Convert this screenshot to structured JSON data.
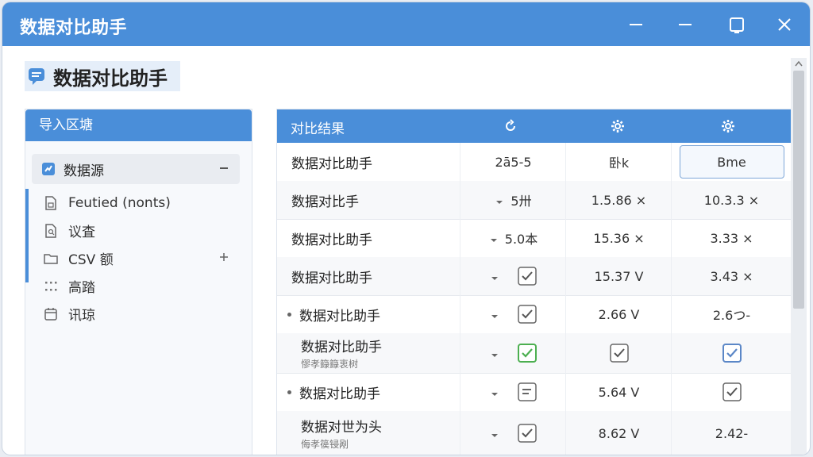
{
  "window": {
    "title": "数据对比助手",
    "controls": [
      "minimize-icon",
      "maximize-icon",
      "close-icon"
    ]
  },
  "app": {
    "name": "数据对比助手",
    "logo": "chat-bubble-icon"
  },
  "left_panel": {
    "title": "导入区塘",
    "source": {
      "label": "数据源",
      "icon": "data-source-icon"
    },
    "items": [
      {
        "label": "Feutied (nonts)",
        "icon": "file-table-icon"
      },
      {
        "label": "议査",
        "icon": "document-search-icon"
      },
      {
        "label": "CSV 额",
        "icon": "folder-icon"
      },
      {
        "label": "高踏",
        "icon": "dots-grid-icon"
      },
      {
        "label": "讯琼",
        "icon": "calendar-icon"
      }
    ]
  },
  "right_panel": {
    "title": "对比结果",
    "header_icons": [
      "refresh-icon",
      "gear-icon",
      "gear-icon"
    ],
    "rows": [
      {
        "name": "数据对比助手",
        "c1": "2ā5-5",
        "c2": "卧k",
        "c3": "Bme"
      },
      {
        "name": "数据对比手",
        "c1": "5卅",
        "c2": "1.5.86 ×",
        "c3": "10.3.3 ×"
      },
      {
        "name": "数据对比助手",
        "c1": "5.0本",
        "c2": "15.36 ×",
        "c3": "3.33 ×"
      },
      {
        "name": "数据对比助手",
        "c1": "",
        "c2": "15.37 V",
        "c3": "3.43 ×"
      },
      {
        "name": "数据对比助手",
        "c1": "",
        "c2": "2.66 V",
        "c3": "2.6つ-"
      },
      {
        "name": "数据对比助手",
        "sub": "憀孝籙籙衷树",
        "c1": "",
        "c2": "",
        "c3": ""
      },
      {
        "name": "数据对比助手",
        "c1": "",
        "c2": "5.64 V",
        "c3": ""
      },
      {
        "name": "数据对世为头",
        "sub": "侮孝篌锓剐",
        "c1": "",
        "c2": "8.62 V",
        "c3": "2.42-"
      }
    ]
  },
  "colors": {
    "accent": "#4a8ed9",
    "check_green": "#4caf50",
    "check_blue": "#5b87c7"
  }
}
